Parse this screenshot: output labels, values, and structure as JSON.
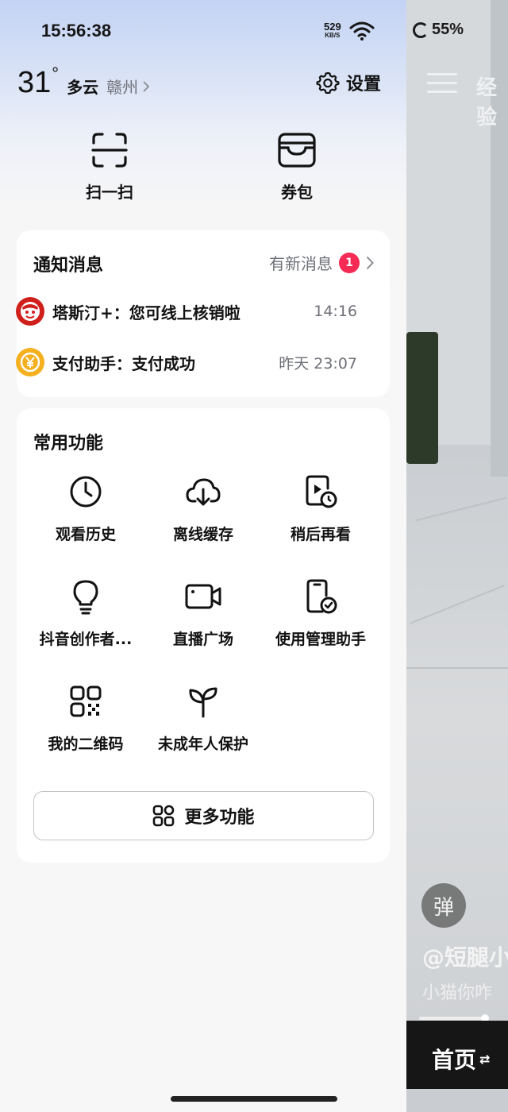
{
  "status_bar": {
    "time": "15:56:38",
    "net_speed_value": "529",
    "net_speed_unit": "KB/S",
    "battery": "55%",
    "wifi_icon": "wifi-icon"
  },
  "weather": {
    "temperature": "31",
    "degree_symbol": "°",
    "condition": "多云",
    "city": "赣州"
  },
  "settings_label": "设置",
  "shortcuts": {
    "scan_label": "扫一扫",
    "coupon_label": "券包"
  },
  "notifications": {
    "title": "通知消息",
    "new_label": "有新消息",
    "badge_count": "1",
    "messages": [
      {
        "text": "塔斯汀+：您可线上核销啦",
        "time": "14:16"
      },
      {
        "text": "支付助手：支付成功",
        "time": "昨天 23:07"
      }
    ]
  },
  "features": {
    "title": "常用功能",
    "items": [
      {
        "label": "观看历史",
        "icon": "clock-icon"
      },
      {
        "label": "离线缓存",
        "icon": "cloud-download-icon"
      },
      {
        "label": "稍后再看",
        "icon": "watch-later-icon"
      },
      {
        "label": "抖音创作者...",
        "icon": "lightbulb-icon"
      },
      {
        "label": "直播广场",
        "icon": "video-camera-icon"
      },
      {
        "label": "使用管理助手",
        "icon": "phone-check-icon"
      },
      {
        "label": "我的二维码",
        "icon": "qr-code-icon"
      },
      {
        "label": "未成年人保护",
        "icon": "sprout-icon"
      }
    ],
    "more_label": "更多功能"
  },
  "background_video": {
    "top_tab_text": "经验",
    "danmu_label": "弹",
    "author": "@短腿小",
    "description": "小猫你咋",
    "home_tab": "首页",
    "home_tab_suffix": "⇄"
  },
  "colors": {
    "badge": "#f52a55",
    "drawer_gradient_top": "#c3d3f4",
    "card_bg": "#ffffff"
  }
}
